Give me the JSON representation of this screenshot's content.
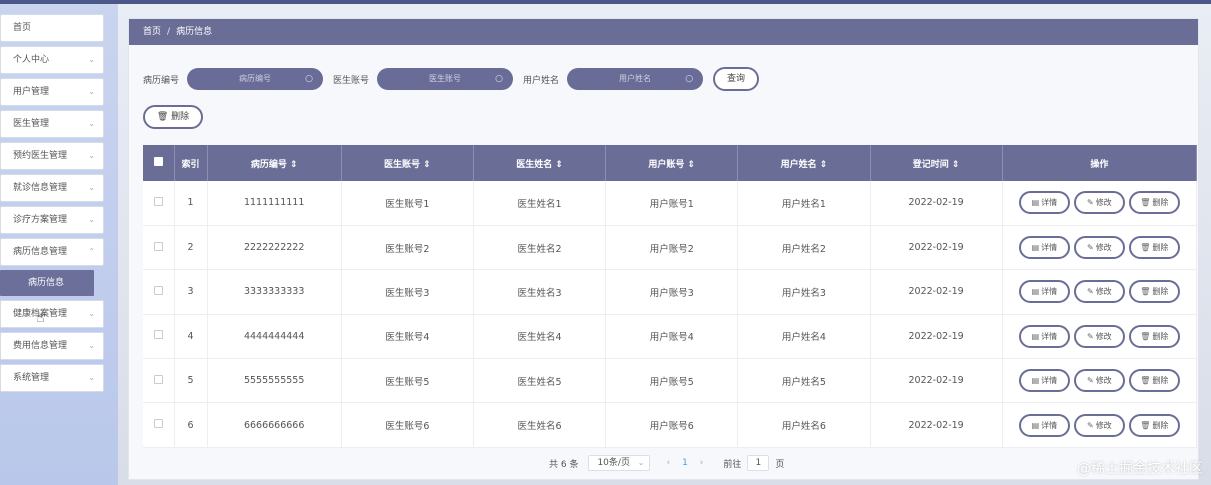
{
  "sidebar": {
    "items": [
      {
        "label": "首页",
        "has_chevron": false
      },
      {
        "label": "个人中心",
        "has_chevron": true
      },
      {
        "label": "用户管理",
        "has_chevron": true
      },
      {
        "label": "医生管理",
        "has_chevron": true
      },
      {
        "label": "预约医生管理",
        "has_chevron": true
      },
      {
        "label": "就诊信息管理",
        "has_chevron": true
      },
      {
        "label": "诊疗方案管理",
        "has_chevron": true
      },
      {
        "label": "病历信息管理",
        "has_chevron": true
      }
    ],
    "sub_item": {
      "label": "病历信息"
    },
    "items_after": [
      {
        "label": "健康档案管理"
      },
      {
        "label": "费用信息管理"
      },
      {
        "label": "系统管理"
      }
    ],
    "chevron": "⌄"
  },
  "breadcrumb": {
    "home": "首页",
    "separator": "/",
    "current": "病历信息"
  },
  "search": {
    "fields": [
      {
        "label": "病历编号",
        "placeholder": "病历编号"
      },
      {
        "label": "医生账号",
        "placeholder": "医生账号"
      },
      {
        "label": "用户姓名",
        "placeholder": "用户姓名"
      }
    ],
    "search_icon": "magnifier-icon",
    "query_label": "查询"
  },
  "toolbar": {
    "delete_label": "删除"
  },
  "table": {
    "columns": [
      "索引",
      "病历编号 ⇕",
      "医生账号 ⇕",
      "医生姓名 ⇕",
      "用户账号 ⇕",
      "用户姓名 ⇕",
      "登记时间 ⇕",
      "操作"
    ],
    "rows": [
      {
        "idx": "1",
        "record_no": "1111111111",
        "doctor_acct": "医生账号1",
        "doctor_name": "医生姓名1",
        "user_acct": "用户账号1",
        "user_name": "用户姓名1",
        "date": "2022-02-19"
      },
      {
        "idx": "2",
        "record_no": "2222222222",
        "doctor_acct": "医生账号2",
        "doctor_name": "医生姓名2",
        "user_acct": "用户账号2",
        "user_name": "用户姓名2",
        "date": "2022-02-19"
      },
      {
        "idx": "3",
        "record_no": "3333333333",
        "doctor_acct": "医生账号3",
        "doctor_name": "医生姓名3",
        "user_acct": "用户账号3",
        "user_name": "用户姓名3",
        "date": "2022-02-19"
      },
      {
        "idx": "4",
        "record_no": "4444444444",
        "doctor_acct": "医生账号4",
        "doctor_name": "医生姓名4",
        "user_acct": "用户账号4",
        "user_name": "用户姓名4",
        "date": "2022-02-19"
      },
      {
        "idx": "5",
        "record_no": "5555555555",
        "doctor_acct": "医生账号5",
        "doctor_name": "医生姓名5",
        "user_acct": "用户账号5",
        "user_name": "用户姓名5",
        "date": "2022-02-19"
      },
      {
        "idx": "6",
        "record_no": "6666666666",
        "doctor_acct": "医生账号6",
        "doctor_name": "医生姓名6",
        "user_acct": "用户账号6",
        "user_name": "用户姓名6",
        "date": "2022-02-19"
      }
    ],
    "actions": {
      "detail": "详情",
      "edit": "修改",
      "delete": "删除"
    }
  },
  "pagination": {
    "total": "共 6 条",
    "page_size": "10条/页",
    "current_page": "1",
    "goto_label": "前往",
    "goto_value": "1",
    "page_unit": "页"
  },
  "watermark": "@稀土掘金技术社区",
  "colors": {
    "accent": "#6a6d96",
    "sidebar_bg": "#c3cfee",
    "header_line": "#4a5788"
  }
}
